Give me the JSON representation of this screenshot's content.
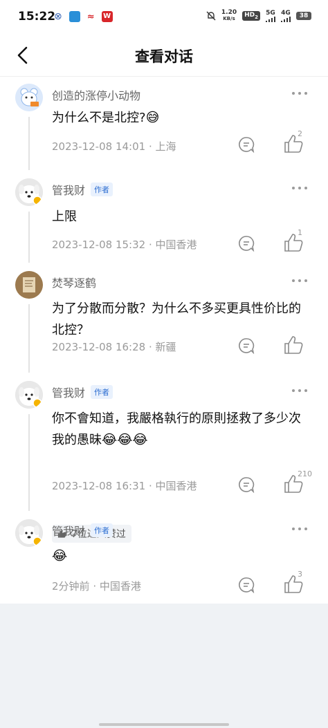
{
  "status_bar": {
    "time": "15:22",
    "net_speed_value": "1.20",
    "net_speed_unit": "KB/s",
    "hd_label": "HD",
    "hd_sub": "2",
    "signal1_label": "5G",
    "signal2_label": "4G",
    "battery": "38"
  },
  "nav": {
    "title": "查看对话"
  },
  "comments": [
    {
      "user": "创造的涨停小动物",
      "text": "为什么不是北控?",
      "emoji": "😅",
      "time": "2023-12-08 14:01",
      "location": "上海",
      "likes": "2"
    },
    {
      "user": "管我财",
      "badge": "作者",
      "text": "上限",
      "time": "2023-12-08 15:32",
      "location": "中国香港",
      "likes": "1"
    },
    {
      "user": "焚琴逐鹤",
      "text_line1": "为了分散而分散？为什么不多买更具性价比的",
      "text_line2": "北控？",
      "time": "2023-12-08 16:28",
      "location": "新疆"
    },
    {
      "user": "管我财",
      "badge": "作者",
      "text_line1": "你不會知道，我嚴格執行的原則拯救了多少次",
      "text_line2": "我的愚昧",
      "emojis": "😂😂😂",
      "upvote_text": "7位达人赞过",
      "time": "2023-12-08 16:31",
      "location": "中国香港",
      "likes": "210"
    },
    {
      "user": "管我财",
      "badge": "作者",
      "emoji": "😂",
      "time": "2分钟前",
      "location": "中国香港",
      "likes": "3"
    }
  ],
  "meta_separator": " · ",
  "colors": {
    "accent_blue": "#2f6fd1",
    "meta_gray": "#9a9a9a",
    "bottom_bg": "#eff2f5"
  }
}
